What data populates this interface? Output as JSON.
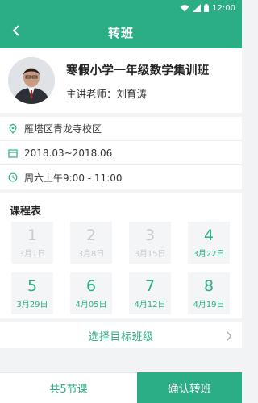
{
  "status_bar": {
    "time": "12:00"
  },
  "header": {
    "title": "转班"
  },
  "class_info": {
    "name": "寒假小学一年级数学集训班",
    "teacher": "主讲老师：刘育涛"
  },
  "meta": {
    "location": "雁塔区青龙寺校区",
    "period": "2018.03~2018.06",
    "time": "周六上午9:00 - 11:00"
  },
  "schedule": {
    "title": "课程表",
    "lessons": [
      {
        "number": "1",
        "date": "3月1日",
        "status": "past"
      },
      {
        "number": "2",
        "date": "3月8日",
        "status": "past"
      },
      {
        "number": "3",
        "date": "3月15日",
        "status": "past"
      },
      {
        "number": "4",
        "date": "3月22日",
        "status": "upcoming"
      },
      {
        "number": "5",
        "date": "3月29日",
        "status": "upcoming"
      },
      {
        "number": "6",
        "date": "4月05日",
        "status": "upcoming"
      },
      {
        "number": "7",
        "date": "4月12日",
        "status": "upcoming"
      },
      {
        "number": "8",
        "date": "4月19日",
        "status": "upcoming"
      }
    ]
  },
  "target": {
    "label": "选择目标班级"
  },
  "footer": {
    "count_label": "共5节课",
    "confirm_label": "确认转班"
  },
  "colors": {
    "accent": "#2bae86",
    "past": "#c8cbcf"
  }
}
